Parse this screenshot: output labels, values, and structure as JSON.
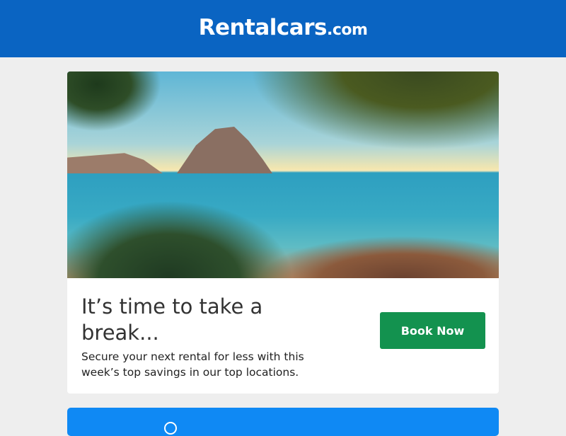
{
  "header": {
    "logo_main": "Rentalcars",
    "logo_suffix": ".com",
    "color": "#0a64c2"
  },
  "promo": {
    "title": "It’s time to take a break...",
    "description": "Secure your next rental for less with this week’s top savings in our top locations.",
    "button_label": "Book Now",
    "button_color": "#13924f"
  },
  "banner": {
    "color": "#0f89f4",
    "icon": "circle-icon"
  }
}
